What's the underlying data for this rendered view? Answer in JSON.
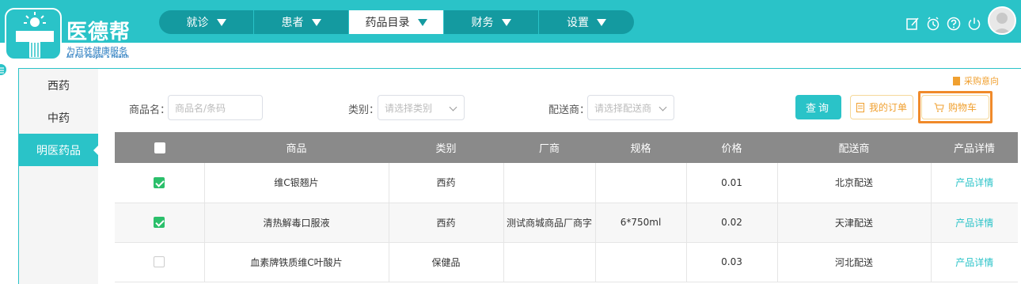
{
  "brand": {
    "title": "医德帮",
    "subtitle": "为百姓健康服务",
    "english": "All For People' s Health"
  },
  "topnav": [
    {
      "label": "就诊",
      "active": false
    },
    {
      "label": "患者",
      "active": false
    },
    {
      "label": "药品目录",
      "active": true
    },
    {
      "label": "财务",
      "active": false
    },
    {
      "label": "设置",
      "active": false
    }
  ],
  "header_icons": [
    "edit-icon",
    "bell-icon",
    "help-icon",
    "power-icon",
    "user-avatar"
  ],
  "sidebar": {
    "items": [
      {
        "label": "西药",
        "active": false
      },
      {
        "label": "中药",
        "active": false
      },
      {
        "label": "明医药品",
        "active": true
      }
    ]
  },
  "filters": {
    "purchase_intent": "采购意向",
    "product_name_label": "商品名：",
    "product_name_placeholder": "商品名/条码",
    "category_label": "类别：",
    "category_placeholder": "请选择类别",
    "distributor_label": "配送商：",
    "distributor_placeholder": "请选择配送商",
    "query_button": "查询",
    "my_orders_button": "我的订单",
    "cart_button": "购物车"
  },
  "table": {
    "headers": [
      "商品",
      "类别",
      "厂商",
      "规格",
      "价格",
      "配送商",
      "产品详情"
    ],
    "rows": [
      {
        "checked": true,
        "product": "维C银翘片",
        "category": "西药",
        "manufacturer": "",
        "spec": "",
        "price": "0.01",
        "distributor": "北京配送",
        "detail": "产品详情"
      },
      {
        "checked": true,
        "product": "清热解毒口服液",
        "category": "西药",
        "manufacturer": "测试商城商品厂商字",
        "spec": "6*750ml",
        "price": "0.02",
        "distributor": "天津配送",
        "detail": "产品详情"
      },
      {
        "checked": false,
        "product": "血素牌铁质维C叶酸片",
        "category": "保健品",
        "manufacturer": "",
        "spec": "",
        "price": "0.03",
        "distributor": "河北配送",
        "detail": "产品详情"
      }
    ]
  },
  "colors": {
    "primary": "#2ac3c8",
    "nav_dark": "#149aa0",
    "accent_orange": "#f0a030",
    "highlight": "#f08a2a",
    "check_green": "#2bbf6b",
    "table_header": "#8a8a8a"
  }
}
